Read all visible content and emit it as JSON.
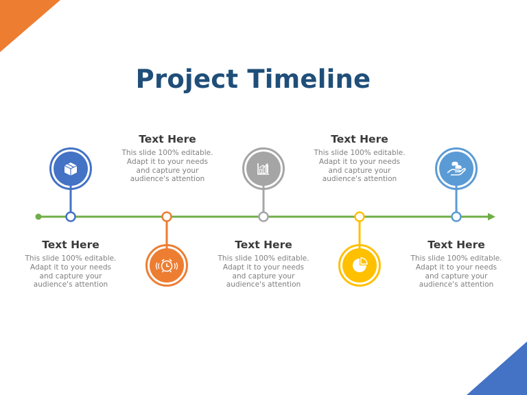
{
  "slide": {
    "title": "Project Timeline",
    "colors": {
      "title": "#1f4e79",
      "line": "#70ad47",
      "corner_top_left": "#ed7d31",
      "corner_bottom_right": "#4472c4"
    }
  },
  "milestones": [
    {
      "heading": "Text Here",
      "body": "This slide 100% editable. Adapt it to your needs and capture your audience's attention",
      "icon": "box-icon",
      "color": "#4472c4",
      "position": "above"
    },
    {
      "heading": "Text Here",
      "body": "This slide 100% editable. Adapt it to your needs and capture your audience's attention",
      "icon": "alarm-clock-icon",
      "color": "#ed7d31",
      "position": "below"
    },
    {
      "heading": "Text Here",
      "body": "This slide 100% editable. Adapt it to your needs and capture your audience's attention",
      "icon": "bar-chart-icon",
      "color": "#a5a5a5",
      "position": "above"
    },
    {
      "heading": "Text Here",
      "body": "This slide 100% editable. Adapt it to your needs and capture your audience's attention",
      "icon": "pie-chart-icon",
      "color": "#ffc000",
      "position": "below"
    },
    {
      "heading": "Text Here",
      "body": "This slide 100% editable. Adapt it to your needs and capture your audience's attention",
      "icon": "hand-coins-icon",
      "color": "#5b9bd5",
      "position": "above"
    }
  ]
}
